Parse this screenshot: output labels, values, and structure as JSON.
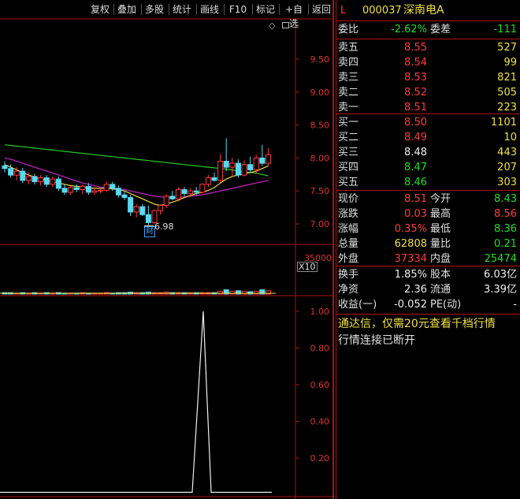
{
  "toolbar": {
    "buttons": [
      "复权",
      "叠加",
      "多股",
      "统计",
      "画线",
      "F10",
      "标记",
      "+自选",
      "返回"
    ],
    "diamond": "◇",
    "window_icon": "window-toggle-icon"
  },
  "chart_data": {
    "type": "candlestick",
    "price_axis": {
      "ticks": [
        "9.50",
        "9.00",
        "8.50",
        "8.00",
        "7.50",
        "7.00"
      ],
      "range": [
        6.9,
        9.6
      ]
    },
    "low_marker": "6.98",
    "finance_tag": "财",
    "volume_axis": {
      "tick": "35000",
      "multiplier": "X10"
    },
    "indicator_axis": {
      "ticks": [
        "1.00",
        "0.80",
        "0.60",
        "0.40",
        "0.20"
      ],
      "range": [
        0,
        1.08
      ]
    },
    "candles": [
      {
        "o": 7.88,
        "h": 7.95,
        "l": 7.78,
        "c": 7.84
      },
      {
        "o": 7.84,
        "h": 7.9,
        "l": 7.7,
        "c": 7.74
      },
      {
        "o": 7.74,
        "h": 7.86,
        "l": 7.66,
        "c": 7.8
      },
      {
        "o": 7.8,
        "h": 7.85,
        "l": 7.62,
        "c": 7.66
      },
      {
        "o": 7.66,
        "h": 7.78,
        "l": 7.6,
        "c": 7.72
      },
      {
        "o": 7.72,
        "h": 7.76,
        "l": 7.6,
        "c": 7.64
      },
      {
        "o": 7.64,
        "h": 7.74,
        "l": 7.58,
        "c": 7.7
      },
      {
        "o": 7.7,
        "h": 7.74,
        "l": 7.56,
        "c": 7.6
      },
      {
        "o": 7.6,
        "h": 7.72,
        "l": 7.56,
        "c": 7.68
      },
      {
        "o": 7.68,
        "h": 7.72,
        "l": 7.5,
        "c": 7.54
      },
      {
        "o": 7.54,
        "h": 7.6,
        "l": 7.44,
        "c": 7.48
      },
      {
        "o": 7.48,
        "h": 7.58,
        "l": 7.44,
        "c": 7.55
      },
      {
        "o": 7.55,
        "h": 7.6,
        "l": 7.48,
        "c": 7.52
      },
      {
        "o": 7.52,
        "h": 7.6,
        "l": 7.45,
        "c": 7.57
      },
      {
        "o": 7.57,
        "h": 7.62,
        "l": 7.44,
        "c": 7.48
      },
      {
        "o": 7.48,
        "h": 7.56,
        "l": 7.44,
        "c": 7.5
      },
      {
        "o": 7.5,
        "h": 7.54,
        "l": 7.46,
        "c": 7.51
      },
      {
        "o": 7.51,
        "h": 7.64,
        "l": 7.48,
        "c": 7.6
      },
      {
        "o": 7.6,
        "h": 7.64,
        "l": 7.5,
        "c": 7.54
      },
      {
        "o": 7.54,
        "h": 7.58,
        "l": 7.4,
        "c": 7.44
      },
      {
        "o": 7.44,
        "h": 7.5,
        "l": 7.36,
        "c": 7.4
      },
      {
        "o": 7.4,
        "h": 7.44,
        "l": 7.12,
        "c": 7.18
      },
      {
        "o": 7.18,
        "h": 7.3,
        "l": 7.1,
        "c": 7.26
      },
      {
        "o": 7.26,
        "h": 7.3,
        "l": 7.12,
        "c": 7.14
      },
      {
        "o": 7.14,
        "h": 7.28,
        "l": 6.98,
        "c": 7.02
      },
      {
        "o": 7.02,
        "h": 7.22,
        "l": 7.0,
        "c": 7.2
      },
      {
        "o": 7.2,
        "h": 7.3,
        "l": 7.14,
        "c": 7.28
      },
      {
        "o": 7.28,
        "h": 7.45,
        "l": 7.24,
        "c": 7.42
      },
      {
        "o": 7.42,
        "h": 7.5,
        "l": 7.36,
        "c": 7.38
      },
      {
        "o": 7.38,
        "h": 7.56,
        "l": 7.34,
        "c": 7.52
      },
      {
        "o": 7.52,
        "h": 7.56,
        "l": 7.42,
        "c": 7.46
      },
      {
        "o": 7.46,
        "h": 7.54,
        "l": 7.42,
        "c": 7.5
      },
      {
        "o": 7.5,
        "h": 7.56,
        "l": 7.44,
        "c": 7.48
      },
      {
        "o": 7.48,
        "h": 7.62,
        "l": 7.46,
        "c": 7.6
      },
      {
        "o": 7.6,
        "h": 7.74,
        "l": 7.56,
        "c": 7.7
      },
      {
        "o": 7.7,
        "h": 7.78,
        "l": 7.64,
        "c": 7.66
      },
      {
        "o": 7.66,
        "h": 8.06,
        "l": 7.62,
        "c": 7.95
      },
      {
        "o": 7.95,
        "h": 8.3,
        "l": 7.8,
        "c": 7.86
      },
      {
        "o": 7.86,
        "h": 8.0,
        "l": 7.72,
        "c": 7.92
      },
      {
        "o": 7.92,
        "h": 7.98,
        "l": 7.7,
        "c": 7.74
      },
      {
        "o": 7.74,
        "h": 7.96,
        "l": 7.72,
        "c": 7.9
      },
      {
        "o": 7.9,
        "h": 8.02,
        "l": 7.78,
        "c": 7.82
      },
      {
        "o": 7.82,
        "h": 8.05,
        "l": 7.76,
        "c": 8.0
      },
      {
        "o": 8.0,
        "h": 8.2,
        "l": 7.88,
        "c": 7.92
      },
      {
        "o": 7.92,
        "h": 8.15,
        "l": 7.88,
        "c": 8.05
      }
    ],
    "volumes": [
      0.3,
      0.3,
      0.2,
      0.3,
      0.2,
      0.3,
      0.2,
      0.3,
      0.2,
      0.3,
      0.2,
      0.2,
      0.2,
      0.3,
      0.2,
      0.2,
      0.2,
      0.3,
      0.2,
      0.3,
      0.3,
      0.4,
      0.3,
      0.3,
      0.4,
      0.3,
      0.3,
      0.4,
      0.3,
      0.3,
      0.3,
      0.3,
      0.3,
      0.3,
      0.3,
      0.3,
      0.6,
      0.9,
      0.6,
      0.7,
      0.6,
      0.5,
      0.6,
      0.9,
      0.7
    ],
    "ma_green": [
      8.2,
      8.19,
      8.18,
      8.17,
      8.16,
      8.15,
      8.14,
      8.13,
      8.12,
      8.11,
      8.1,
      8.09,
      8.08,
      8.07,
      8.06,
      8.05,
      8.04,
      8.03,
      8.02,
      8.01,
      8.0,
      7.99,
      7.98,
      7.97,
      7.96,
      7.95,
      7.94,
      7.93,
      7.92,
      7.91,
      7.9,
      7.89,
      7.88,
      7.87,
      7.86,
      7.85,
      7.84,
      7.83,
      7.82,
      7.8,
      7.79,
      7.78,
      7.77,
      7.75,
      7.73
    ],
    "ma_magenta": [
      8.0,
      7.98,
      7.95,
      7.92,
      7.89,
      7.86,
      7.83,
      7.8,
      7.77,
      7.74,
      7.71,
      7.68,
      7.65,
      7.62,
      7.6,
      7.58,
      7.56,
      7.55,
      7.54,
      7.53,
      7.52,
      7.5,
      7.48,
      7.46,
      7.44,
      7.42,
      7.41,
      7.4,
      7.4,
      7.4,
      7.41,
      7.42,
      7.43,
      7.44,
      7.46,
      7.48,
      7.5,
      7.52,
      7.54,
      7.56,
      7.58,
      7.6,
      7.62,
      7.64,
      7.66
    ],
    "ma_yellow": [
      7.9,
      7.86,
      7.82,
      7.78,
      7.74,
      7.71,
      7.68,
      7.66,
      7.64,
      7.62,
      7.6,
      7.58,
      7.57,
      7.56,
      7.55,
      7.54,
      7.54,
      7.54,
      7.53,
      7.52,
      7.5,
      7.46,
      7.42,
      7.38,
      7.34,
      7.3,
      7.28,
      7.3,
      7.33,
      7.36,
      7.4,
      7.43,
      7.46,
      7.48,
      7.51,
      7.55,
      7.62,
      7.68,
      7.72,
      7.74,
      7.76,
      7.78,
      7.8,
      7.84,
      7.88
    ],
    "indicator": [
      0,
      0,
      0,
      0,
      0,
      0,
      0,
      0,
      0,
      0,
      0,
      0,
      0,
      0,
      0,
      0,
      0,
      0,
      0,
      0,
      0,
      0,
      0,
      0,
      0,
      0,
      0,
      0,
      0,
      0,
      0,
      0,
      0,
      0,
      0,
      0,
      0,
      0,
      0,
      0,
      0,
      0,
      0,
      0,
      0
    ],
    "indicator_spike": 1.0
  },
  "panel": {
    "market_letter": "L",
    "code": "000037",
    "name": "深南电A",
    "weibi_label": "委比",
    "weibi": "-2.62%",
    "weicha_label": "委差",
    "weicha": "-111",
    "asks": [
      {
        "label": "卖五",
        "price": "8.55",
        "vol": "527"
      },
      {
        "label": "卖四",
        "price": "8.54",
        "vol": "99"
      },
      {
        "label": "卖三",
        "price": "8.53",
        "vol": "821"
      },
      {
        "label": "卖二",
        "price": "8.52",
        "vol": "505"
      },
      {
        "label": "卖一",
        "price": "8.51",
        "vol": "223"
      }
    ],
    "bids": [
      {
        "label": "买一",
        "price": "8.50",
        "vol": "1101"
      },
      {
        "label": "买二",
        "price": "8.49",
        "vol": "10"
      },
      {
        "label": "买三",
        "price": "8.48",
        "vol": "443"
      },
      {
        "label": "买四",
        "price": "8.47",
        "vol": "207"
      },
      {
        "label": "买五",
        "price": "8.46",
        "vol": "303"
      }
    ],
    "quote": [
      {
        "l1": "现价",
        "v1": "8.51",
        "l2": "今开",
        "v2": "8.43"
      },
      {
        "l1": "涨跌",
        "v1": "0.03",
        "l2": "最高",
        "v2": "8.56"
      },
      {
        "l1": "涨幅",
        "v1": "0.35%",
        "l2": "最低",
        "v2": "8.36"
      },
      {
        "l1": "总量",
        "v1": "62808",
        "l2": "量比",
        "v2": "0.21"
      },
      {
        "l1": "外盘",
        "v1": "37334",
        "l2": "内盘",
        "v2": "25474"
      }
    ],
    "fund": [
      {
        "l1": "换手",
        "v1": "1.85%",
        "l2": "股本",
        "v2": "6.03亿"
      },
      {
        "l1": "净资",
        "v1": "2.36",
        "l2": "流通",
        "v2": "3.39亿"
      },
      {
        "l1": "收益(一)",
        "v1": "-0.052",
        "l2": "PE(动)",
        "v2": "-"
      }
    ],
    "promo": "通达信，仅需20元查看千档行情",
    "status": "行情连接已断开",
    "colors": {
      "up": "#ff3b3b",
      "down": "#22dd22",
      "frame": "#b01010",
      "ma_green": "#22cc22",
      "ma_magenta": "#cc22cc",
      "ma_yellow": "#e8e040"
    }
  }
}
